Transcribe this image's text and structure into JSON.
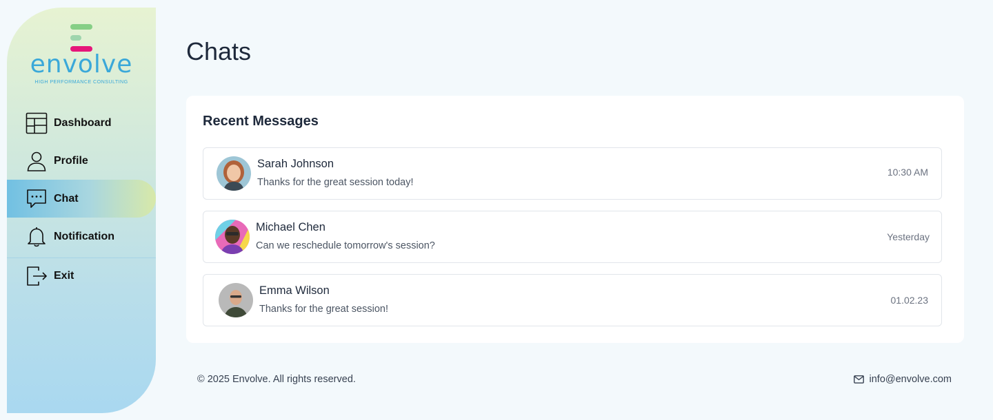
{
  "brand": {
    "name": "envolve",
    "tagline": "HIGH PERFORMANCE CONSULTING",
    "colors": {
      "primary": "#3aa8d9",
      "accent_pink": "#e6167a",
      "accent_green": "#86cf86"
    }
  },
  "sidebar": {
    "items": [
      {
        "label": "Dashboard",
        "icon": "dashboard-icon"
      },
      {
        "label": "Profile",
        "icon": "user-icon"
      },
      {
        "label": "Chat",
        "icon": "chat-bubble-icon",
        "active": true
      },
      {
        "label": "Notification",
        "icon": "bell-icon"
      },
      {
        "label": "Exit",
        "icon": "exit-icon"
      }
    ]
  },
  "main": {
    "title": "Chats",
    "recent": {
      "title": "Recent Messages",
      "messages": [
        {
          "name": "Sarah Johnson",
          "text": "Thanks for the great session today!",
          "time": "10:30 AM"
        },
        {
          "name": "Michael Chen",
          "text": "Can we reschedule tomorrow's session?",
          "time": "Yesterday"
        },
        {
          "name": "Emma Wilson",
          "text": "Thanks for the great session!",
          "time": "01.02.23"
        }
      ]
    }
  },
  "footer": {
    "copyright": "© 2025 Envolve. All rights reserved.",
    "email": "info@envolve.com",
    "email_icon": "mail-icon"
  }
}
